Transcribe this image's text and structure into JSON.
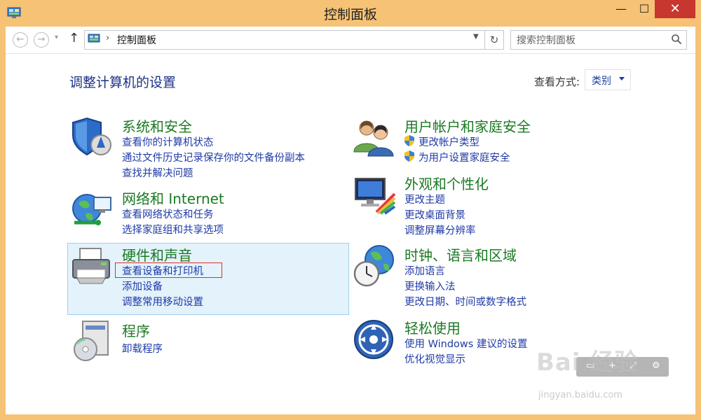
{
  "window": {
    "title": "控制面板",
    "minimize": "—",
    "maximize": "☐",
    "close": "✕"
  },
  "nav": {
    "back": "←",
    "forward": "→",
    "recent": "▾",
    "up": "↑",
    "breadcrumb_sep": "›",
    "address": "控制面板",
    "refresh": "↻",
    "search_placeholder": "搜索控制面板"
  },
  "page": {
    "title": "调整计算机的设置",
    "view_label": "查看方式:",
    "view_value": "类别"
  },
  "left_categories": [
    {
      "title": "系统和安全",
      "icon": "shield-icon",
      "links": [
        "查看你的计算机状态",
        "通过文件历史记录保存你的文件备份副本",
        "查找并解决问题"
      ]
    },
    {
      "title": "网络和 Internet",
      "icon": "network-globe-icon",
      "links": [
        "查看网络状态和任务",
        "选择家庭组和共享选项"
      ]
    },
    {
      "title": "硬件和声音",
      "icon": "printer-icon",
      "links": [
        "查看设备和打印机",
        "添加设备",
        "调整常用移动设置"
      ]
    },
    {
      "title": "程序",
      "icon": "programs-disc-icon",
      "links": [
        "卸载程序"
      ]
    }
  ],
  "right_categories": [
    {
      "title": "用户帐户和家庭安全",
      "icon": "users-icon",
      "links": [
        "更改帐户类型",
        "为用户设置家庭安全"
      ]
    },
    {
      "title": "外观和个性化",
      "icon": "monitor-palette-icon",
      "links": [
        "更改主题",
        "更改桌面背景",
        "调整屏幕分辨率"
      ]
    },
    {
      "title": "时钟、语言和区域",
      "icon": "clock-globe-icon",
      "links": [
        "添加语言",
        "更换输入法",
        "更改日期、时间或数字格式"
      ]
    },
    {
      "title": "轻松使用",
      "icon": "ease-of-access-icon",
      "links": [
        "使用 Windows 建议的设置",
        "优化视觉显示"
      ]
    }
  ],
  "watermark": {
    "main": "Bai 经验",
    "sub": "jingyan.baidu.com"
  },
  "colors": {
    "title_bar": "#f6c275",
    "close_button": "#c7362f",
    "category_title": "#1b7a23",
    "link": "#1f3aa6",
    "highlight_bg": "#e3f2fb",
    "highlight_border": "#9ed0ee",
    "annotation_red": "#e0302a"
  }
}
